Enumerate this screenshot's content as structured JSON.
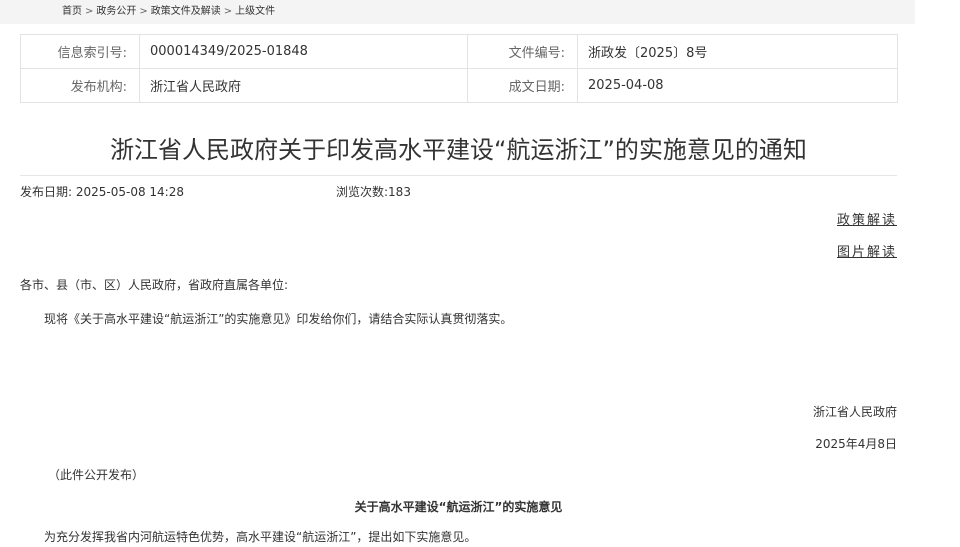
{
  "breadcrumb": {
    "items": [
      "首页",
      "政务公开",
      "政策文件及解读",
      "上级文件"
    ],
    "separator": ">"
  },
  "info": {
    "index_label": "信息索引号:",
    "index_value": "000014349/2025-01848",
    "docno_label": "文件编号:",
    "docno_value": "浙政发〔2025〕8号",
    "agency_label": "发布机构:",
    "agency_value": "浙江省人民政府",
    "date_label": "成文日期:",
    "date_value": "2025-04-08"
  },
  "title": "浙江省人民政府关于印发高水平建设“航运浙江”的实施意见的通知",
  "meta": {
    "publish_date": "发布日期:  2025-05-08 14:28",
    "views": "浏览次数:183"
  },
  "links": {
    "policy_interpretation": "政策解读",
    "image_interpretation": "图片解读"
  },
  "body": {
    "salutation": "各市、县（市、区）人民政府，省政府直属各单位:",
    "paragraph1": "现将《关于高水平建设“航运浙江”的实施意见》印发给你们，请结合实际认真贯彻落实。",
    "issuer": "浙江省人民政府",
    "issue_date": "2025年4月8日",
    "public_note": "（此件公开发布）",
    "subtitle": "关于高水平建设“航运浙江”的实施意见",
    "paragraph2": "为充分发挥我省内河航运特色优势，高水平建设“航运浙江”，提出如下实施意见。"
  }
}
